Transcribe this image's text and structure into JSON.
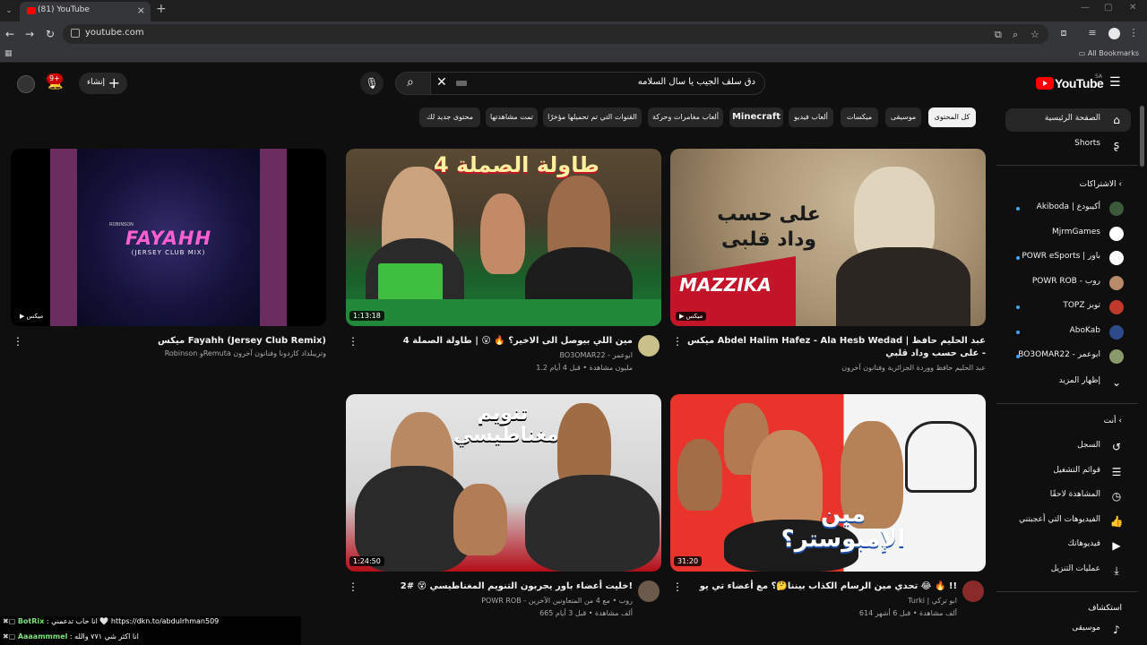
{
  "browser": {
    "tab_title": "(81) YouTube",
    "url": "youtube.com",
    "all_bookmarks": "All Bookmarks"
  },
  "header": {
    "logo": "YouTube",
    "logo_region": "SA",
    "search_query": "دق سلف الجيب يا سال السلامه",
    "create_label": "إنشاء",
    "notif_count": "9+"
  },
  "chips": [
    {
      "label": "كل المحتوى",
      "active": true
    },
    {
      "label": "موسيقى"
    },
    {
      "label": "ميكسات"
    },
    {
      "label": "ألعاب فيديو"
    },
    {
      "label": "Minecraft"
    },
    {
      "label": "ألعاب مغامرات وحركة"
    },
    {
      "label": "القنوات التي تم تحميلها مؤخرًا"
    },
    {
      "label": "تمت مشاهدتها"
    },
    {
      "label": "محتوى جديد لك"
    }
  ],
  "sidebar": {
    "home": "الصفحة الرئيسية",
    "shorts": "Shorts",
    "subs_head": "الاشتراكات",
    "subs": [
      {
        "name": "Akiboda | أكيبودع",
        "color": "#3a5a3a",
        "dot": true
      },
      {
        "name": "MjrmGames",
        "color": "#ffffff",
        "dot": false
      },
      {
        "name": "POWR eSports | باور",
        "color": "#ffffff",
        "dot": true
      },
      {
        "name": "POWR ROB - روب",
        "color": "#b88a6a",
        "dot": false
      },
      {
        "name": "TOPZ توبز",
        "color": "#c0392b",
        "dot": true
      },
      {
        "name": "AboKab",
        "color": "#2d4a8a",
        "dot": true
      },
      {
        "name": "BO3OMAR22 - ابوعمر",
        "color": "#8a9a6a",
        "dot": true
      }
    ],
    "show_more": "إظهار المزيد",
    "you_head": "أنت",
    "you_items": [
      {
        "label": "السجل",
        "icon": "history-icon",
        "glyph": "↺"
      },
      {
        "label": "قوائم التشغيل",
        "icon": "playlists-icon",
        "glyph": "☰"
      },
      {
        "label": "المشاهدة لاحقًا",
        "icon": "watch-later-icon",
        "glyph": "◷"
      },
      {
        "label": "الفيديوهات التي أعجبتني",
        "icon": "like-icon",
        "glyph": "👍"
      },
      {
        "label": "فيديوهاتك",
        "icon": "your-videos-icon",
        "glyph": "▶"
      },
      {
        "label": "عمليات التنزيل",
        "icon": "download-icon",
        "glyph": "⤓"
      }
    ],
    "explore_head": "استكشاف",
    "music": "موسيقى"
  },
  "videos": [
    {
      "title": "ميكس Abdel Halim Hafez - Ala Hesb Wedad | عبد الحليم حافظ - على حسب وداد قلبي",
      "channel": "عبد الحليم حافظ ووردة الجزائرية وفنانون آخرون",
      "meta": "",
      "badge": "ميكس",
      "thumb_text": "على حسب وداد قلبى"
    },
    {
      "title": "مين اللي بيوصل الى الاخير؟ 🔥 😮 | طاولة الصملة 4",
      "channel": "BO3OMAR22 - ابوعمر",
      "meta": "1.2 مليون مشاهدة • قبل 4 أيام",
      "badge": "1:13:18",
      "thumb_text": "طاولة الصملة 4"
    },
    {
      "title": "ميكس Fayahh (Jersey Club Remix)",
      "channel": "Robinson وRemuta وتريبلداد كاردونا وفنانون آخرون",
      "meta": "",
      "badge": "ميكس",
      "thumb_text": "FAYAHH",
      "thumb_sub": "(JERSEY CLUB MIX)",
      "thumb_top": "ROBINSON"
    },
    {
      "title": "تحدي مين الرسام الكذاب بيننا🤔؟ مع أعضاء تي يو 😂 🔥 !!",
      "channel": "Turki | ابو تركي",
      "meta": "614 ألف مشاهدة • قبل 6 أشهر",
      "badge": "31:20",
      "thumb_text": "مين الإمبوستر؟"
    },
    {
      "title": "خليت أعضاء باور يجربون التنويم المغناطيسي 😵 #2!",
      "channel": "POWR ROB - روب • مع 4 من المتعاونين الآخرين",
      "meta": "665 ألف مشاهدة • قبل 3 أيام",
      "badge": "1:24:50",
      "thumb_text": "تنويم مغناطيسي"
    }
  ],
  "chat": {
    "l1_name": "BotRix",
    "l1_text": " : انا حاب تدعمني 🤍 https://dkn.to/abdulrhman509",
    "l2_name": "Aaaammmel",
    "l2_text": " : انا اكثر شي ٧٧١ والله"
  }
}
